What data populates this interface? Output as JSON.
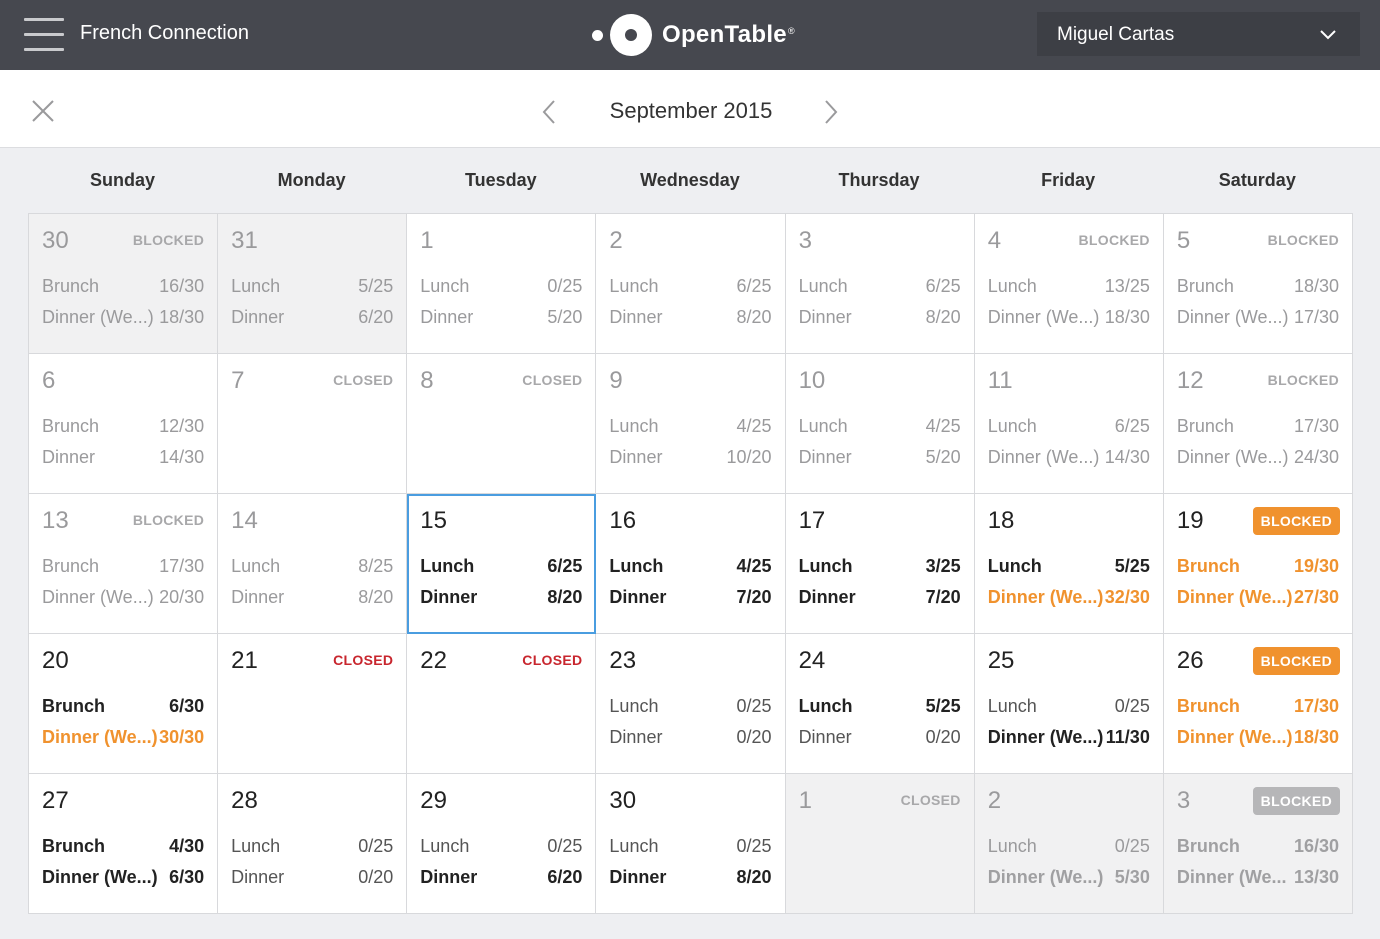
{
  "topbar": {
    "restaurant": "French Connection",
    "logo_text": "OpenTable",
    "logo_tm": "®",
    "user_name": "Miguel Cartas"
  },
  "header": {
    "month": "September 2015"
  },
  "weekdays": [
    "Sunday",
    "Monday",
    "Tuesday",
    "Wednesday",
    "Thursday",
    "Friday",
    "Saturday"
  ],
  "colors": {
    "topbar": "#46484f",
    "accent_orange": "#f0922e",
    "closed_red": "#c8262e",
    "today_outline": "#4a9de0"
  },
  "days": [
    {
      "day": "30",
      "status": "BLOCKED",
      "status_style": "text",
      "faded": true,
      "bg": "past",
      "rows": [
        {
          "label": "Brunch",
          "value": "16/30",
          "style": "normal"
        },
        {
          "label": "Dinner (We...)",
          "value": "18/30",
          "style": "normal"
        }
      ]
    },
    {
      "day": "31",
      "status": "",
      "status_style": "",
      "faded": true,
      "bg": "past",
      "rows": [
        {
          "label": "Lunch",
          "value": "5/25",
          "style": "normal"
        },
        {
          "label": "Dinner",
          "value": "6/20",
          "style": "normal"
        }
      ]
    },
    {
      "day": "1",
      "status": "",
      "status_style": "",
      "faded": true,
      "bg": "white",
      "rows": [
        {
          "label": "Lunch",
          "value": "0/25",
          "style": "normal"
        },
        {
          "label": "Dinner",
          "value": "5/20",
          "style": "normal"
        }
      ]
    },
    {
      "day": "2",
      "status": "",
      "status_style": "",
      "faded": true,
      "bg": "white",
      "rows": [
        {
          "label": "Lunch",
          "value": "6/25",
          "style": "normal"
        },
        {
          "label": "Dinner",
          "value": "8/20",
          "style": "normal"
        }
      ]
    },
    {
      "day": "3",
      "status": "",
      "status_style": "",
      "faded": true,
      "bg": "white",
      "rows": [
        {
          "label": "Lunch",
          "value": "6/25",
          "style": "normal"
        },
        {
          "label": "Dinner",
          "value": "8/20",
          "style": "normal"
        }
      ]
    },
    {
      "day": "4",
      "status": "BLOCKED",
      "status_style": "text",
      "faded": true,
      "bg": "white",
      "rows": [
        {
          "label": "Lunch",
          "value": "13/25",
          "style": "normal"
        },
        {
          "label": "Dinner (We...)",
          "value": "18/30",
          "style": "normal"
        }
      ]
    },
    {
      "day": "5",
      "status": "BLOCKED",
      "status_style": "text",
      "faded": true,
      "bg": "white",
      "rows": [
        {
          "label": "Brunch",
          "value": "18/30",
          "style": "normal"
        },
        {
          "label": "Dinner (We...)",
          "value": "17/30",
          "style": "normal"
        }
      ]
    },
    {
      "day": "6",
      "status": "",
      "status_style": "",
      "faded": true,
      "bg": "white",
      "rows": [
        {
          "label": "Brunch",
          "value": "12/30",
          "style": "normal"
        },
        {
          "label": "Dinner",
          "value": "14/30",
          "style": "normal"
        }
      ]
    },
    {
      "day": "7",
      "status": "CLOSED",
      "status_style": "text",
      "faded": true,
      "bg": "white",
      "rows": []
    },
    {
      "day": "8",
      "status": "CLOSED",
      "status_style": "text",
      "faded": true,
      "bg": "white",
      "rows": []
    },
    {
      "day": "9",
      "status": "",
      "status_style": "",
      "faded": true,
      "bg": "white",
      "rows": [
        {
          "label": "Lunch",
          "value": "4/25",
          "style": "normal"
        },
        {
          "label": "Dinner",
          "value": "10/20",
          "style": "normal"
        }
      ]
    },
    {
      "day": "10",
      "status": "",
      "status_style": "",
      "faded": true,
      "bg": "white",
      "rows": [
        {
          "label": "Lunch",
          "value": "4/25",
          "style": "normal"
        },
        {
          "label": "Dinner",
          "value": "5/20",
          "style": "normal"
        }
      ]
    },
    {
      "day": "11",
      "status": "",
      "status_style": "",
      "faded": true,
      "bg": "white",
      "rows": [
        {
          "label": "Lunch",
          "value": "6/25",
          "style": "normal"
        },
        {
          "label": "Dinner (We...)",
          "value": "14/30",
          "style": "normal"
        }
      ]
    },
    {
      "day": "12",
      "status": "BLOCKED",
      "status_style": "text",
      "faded": true,
      "bg": "white",
      "rows": [
        {
          "label": "Brunch",
          "value": "17/30",
          "style": "normal"
        },
        {
          "label": "Dinner (We...)",
          "value": "24/30",
          "style": "normal"
        }
      ]
    },
    {
      "day": "13",
      "status": "BLOCKED",
      "status_style": "text",
      "faded": true,
      "bg": "white",
      "rows": [
        {
          "label": "Brunch",
          "value": "17/30",
          "style": "normal"
        },
        {
          "label": "Dinner (We...)",
          "value": "20/30",
          "style": "normal"
        }
      ]
    },
    {
      "day": "14",
      "status": "",
      "status_style": "",
      "faded": true,
      "bg": "white",
      "rows": [
        {
          "label": "Lunch",
          "value": "8/25",
          "style": "normal"
        },
        {
          "label": "Dinner",
          "value": "8/20",
          "style": "normal"
        }
      ]
    },
    {
      "day": "15",
      "status": "",
      "status_style": "",
      "faded": false,
      "bg": "white",
      "today": true,
      "rows": [
        {
          "label": "Lunch",
          "value": "6/25",
          "style": "bold"
        },
        {
          "label": "Dinner",
          "value": "8/20",
          "style": "bold"
        }
      ]
    },
    {
      "day": "16",
      "status": "",
      "status_style": "",
      "faded": false,
      "bg": "white",
      "rows": [
        {
          "label": "Lunch",
          "value": "4/25",
          "style": "bold"
        },
        {
          "label": "Dinner",
          "value": "7/20",
          "style": "bold"
        }
      ]
    },
    {
      "day": "17",
      "status": "",
      "status_style": "",
      "faded": false,
      "bg": "white",
      "rows": [
        {
          "label": "Lunch",
          "value": "3/25",
          "style": "bold"
        },
        {
          "label": "Dinner",
          "value": "7/20",
          "style": "bold"
        }
      ]
    },
    {
      "day": "18",
      "status": "",
      "status_style": "",
      "faded": false,
      "bg": "white",
      "rows": [
        {
          "label": "Lunch",
          "value": "5/25",
          "style": "bold"
        },
        {
          "label": "Dinner (We...)",
          "value": "32/30",
          "style": "orange"
        }
      ]
    },
    {
      "day": "19",
      "status": "BLOCKED",
      "status_style": "badge",
      "faded": false,
      "bg": "white",
      "rows": [
        {
          "label": "Brunch",
          "value": "19/30",
          "style": "orange"
        },
        {
          "label": "Dinner (We...)",
          "value": "27/30",
          "style": "orange"
        }
      ]
    },
    {
      "day": "20",
      "status": "",
      "status_style": "",
      "faded": false,
      "bg": "white",
      "rows": [
        {
          "label": "Brunch",
          "value": "6/30",
          "style": "bold"
        },
        {
          "label": "Dinner (We...)",
          "value": "30/30",
          "style": "orange"
        }
      ]
    },
    {
      "day": "21",
      "status": "CLOSED",
      "status_style": "red",
      "faded": false,
      "bg": "white",
      "rows": []
    },
    {
      "day": "22",
      "status": "CLOSED",
      "status_style": "red",
      "faded": false,
      "bg": "white",
      "rows": []
    },
    {
      "day": "23",
      "status": "",
      "status_style": "",
      "faded": false,
      "bg": "white",
      "rows": [
        {
          "label": "Lunch",
          "value": "0/25",
          "style": "normal"
        },
        {
          "label": "Dinner",
          "value": "0/20",
          "style": "normal"
        }
      ]
    },
    {
      "day": "24",
      "status": "",
      "status_style": "",
      "faded": false,
      "bg": "white",
      "rows": [
        {
          "label": "Lunch",
          "value": "5/25",
          "style": "bold"
        },
        {
          "label": "Dinner",
          "value": "0/20",
          "style": "normal"
        }
      ]
    },
    {
      "day": "25",
      "status": "",
      "status_style": "",
      "faded": false,
      "bg": "white",
      "rows": [
        {
          "label": "Lunch",
          "value": "0/25",
          "style": "normal"
        },
        {
          "label": "Dinner (We...)",
          "value": "11/30",
          "style": "bold"
        }
      ]
    },
    {
      "day": "26",
      "status": "BLOCKED",
      "status_style": "badge",
      "faded": false,
      "bg": "white",
      "rows": [
        {
          "label": "Brunch",
          "value": "17/30",
          "style": "orange"
        },
        {
          "label": "Dinner (We...)",
          "value": "18/30",
          "style": "orange"
        }
      ]
    },
    {
      "day": "27",
      "status": "",
      "status_style": "",
      "faded": false,
      "bg": "white",
      "rows": [
        {
          "label": "Brunch",
          "value": "4/30",
          "style": "bold"
        },
        {
          "label": "Dinner (We...)",
          "value": "6/30",
          "style": "bold"
        }
      ]
    },
    {
      "day": "28",
      "status": "",
      "status_style": "",
      "faded": false,
      "bg": "white",
      "rows": [
        {
          "label": "Lunch",
          "value": "0/25",
          "style": "normal"
        },
        {
          "label": "Dinner",
          "value": "0/20",
          "style": "normal"
        }
      ]
    },
    {
      "day": "29",
      "status": "",
      "status_style": "",
      "faded": false,
      "bg": "white",
      "rows": [
        {
          "label": "Lunch",
          "value": "0/25",
          "style": "normal"
        },
        {
          "label": "Dinner",
          "value": "6/20",
          "style": "bold"
        }
      ]
    },
    {
      "day": "30",
      "status": "",
      "status_style": "",
      "faded": false,
      "bg": "white",
      "rows": [
        {
          "label": "Lunch",
          "value": "0/25",
          "style": "normal"
        },
        {
          "label": "Dinner",
          "value": "8/20",
          "style": "bold"
        }
      ]
    },
    {
      "day": "1",
      "status": "CLOSED",
      "status_style": "text",
      "faded": true,
      "bg": "other",
      "rows": []
    },
    {
      "day": "2",
      "status": "",
      "status_style": "",
      "faded": true,
      "bg": "other",
      "rows": [
        {
          "label": "Lunch",
          "value": "0/25",
          "style": "normal"
        },
        {
          "label": "Dinner (We...)",
          "value": "5/30",
          "style": "lightbold"
        }
      ]
    },
    {
      "day": "3",
      "status": "BLOCKED",
      "status_style": "badge-grey",
      "faded": true,
      "bg": "other",
      "rows": [
        {
          "label": "Brunch",
          "value": "16/30",
          "style": "lightbold"
        },
        {
          "label": "Dinner (We...",
          "value": "13/30",
          "style": "lightbold"
        }
      ]
    }
  ]
}
